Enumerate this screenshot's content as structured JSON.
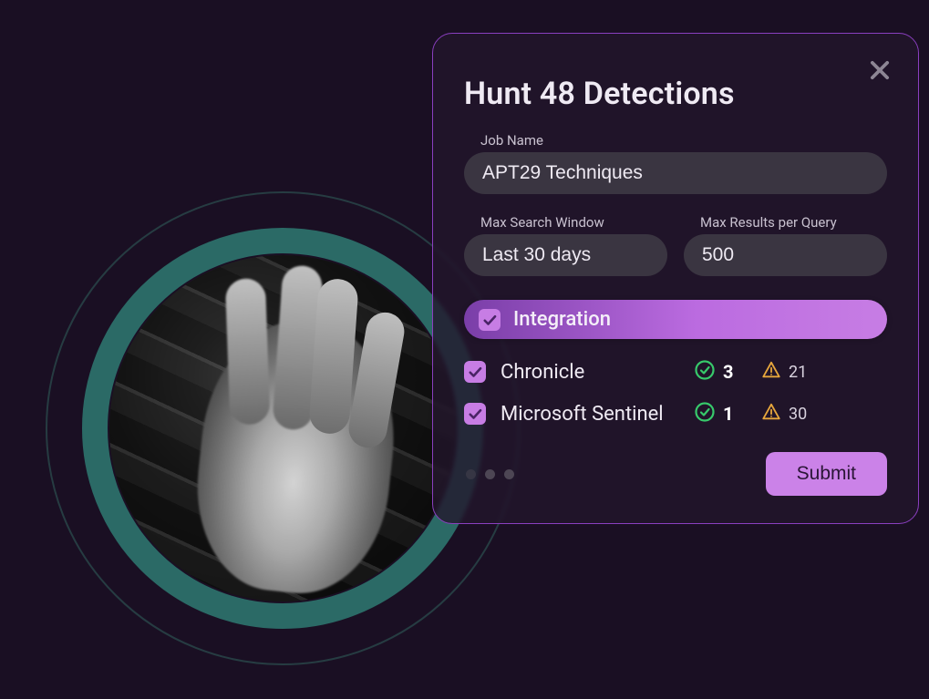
{
  "modal": {
    "title": "Hunt 48 Detections",
    "fields": {
      "job_name": {
        "label": "Job Name",
        "value": "APT29 Techniques"
      },
      "max_window": {
        "label": "Max Search Window",
        "value": "Last 30 days"
      },
      "max_results": {
        "label": "Max Results per Query",
        "value": "500"
      }
    },
    "integration_label": "Integration",
    "integrations": [
      {
        "name": "Chronicle",
        "checked": true,
        "success": "3",
        "warn": "21"
      },
      {
        "name": "Microsoft Sentinel",
        "checked": true,
        "success": "1",
        "warn": "30"
      }
    ],
    "submit_label": "Submit"
  }
}
